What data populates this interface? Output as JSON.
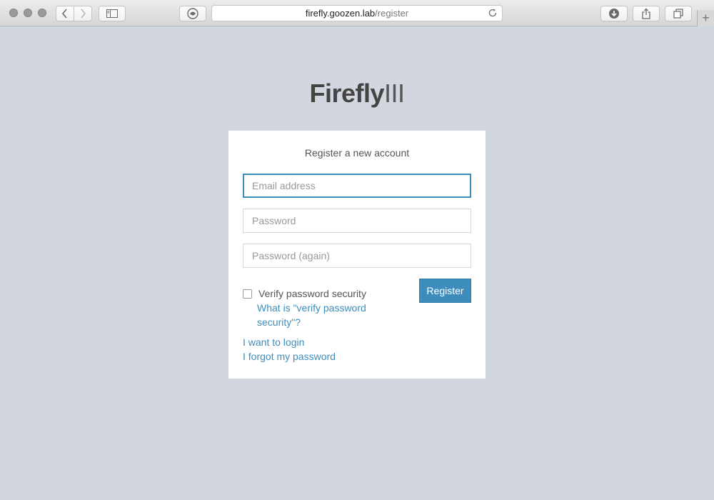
{
  "browser": {
    "url_host": "firefly.goozen.lab",
    "url_path": "/register",
    "new_tab_label": "+"
  },
  "logo": {
    "bold": "Firefly",
    "light": "III"
  },
  "form": {
    "title": "Register a new account",
    "email_placeholder": "Email address",
    "password_placeholder": "Password",
    "password_again_placeholder": "Password (again)",
    "verify_label": "Verify password security",
    "verify_help_link": "What is \"verify password security\"?",
    "register_button": "Register",
    "login_link": "I want to login",
    "forgot_link": "I forgot my password",
    "verify_checked": false
  },
  "colors": {
    "page_background": "#d2d6de",
    "accent": "#3c8dbc"
  }
}
